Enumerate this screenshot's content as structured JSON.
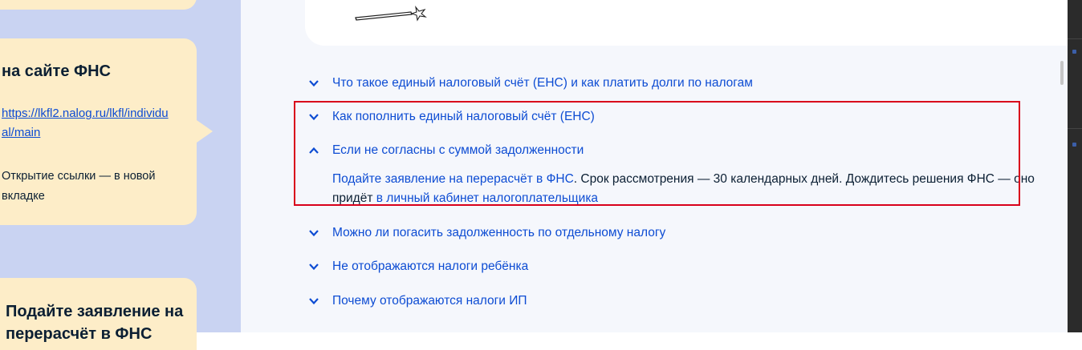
{
  "sidebar": {
    "card": {
      "title": "на сайте ФНС",
      "link": "https://lkfl2.nalog.ru/lkfl/individual/main",
      "note": "Открытие ссылки — в новой вкладке"
    },
    "bottom_card": {
      "title": "Подайте заявление на перерасчёт в ФНС"
    }
  },
  "faq": {
    "items": [
      {
        "question": "Что такое единый налоговый счёт (ЕНС) и как платить долги по налогам",
        "expanded": false
      },
      {
        "question": "Как пополнить единый налоговый счёт (ЕНС)",
        "expanded": false
      },
      {
        "question": "Если не согласны с суммой задолженности",
        "expanded": true
      },
      {
        "question": "Можно ли погасить задолженность по отдельному налогу",
        "expanded": false
      },
      {
        "question": "Не отображаются налоги ребёнка",
        "expanded": false
      },
      {
        "question": "Почему отображаются налоги ИП",
        "expanded": false
      }
    ],
    "answer": {
      "link1": "Подайте заявление на перерасчёт в ФНС",
      "text1": ". Срок рассмотрения — 30 календарных дней. Дождитесь решения ФНС — оно придёт ",
      "link2": "в личный кабинет налогоплательщика"
    }
  },
  "colors": {
    "link": "#0d4cd3",
    "highlight": "#d9001b",
    "sidebar_bg": "#c9d3f2",
    "card_bg": "#fdedc8"
  },
  "icons": {
    "collapsed": "chevron-down-icon",
    "expanded": "chevron-up-icon"
  }
}
